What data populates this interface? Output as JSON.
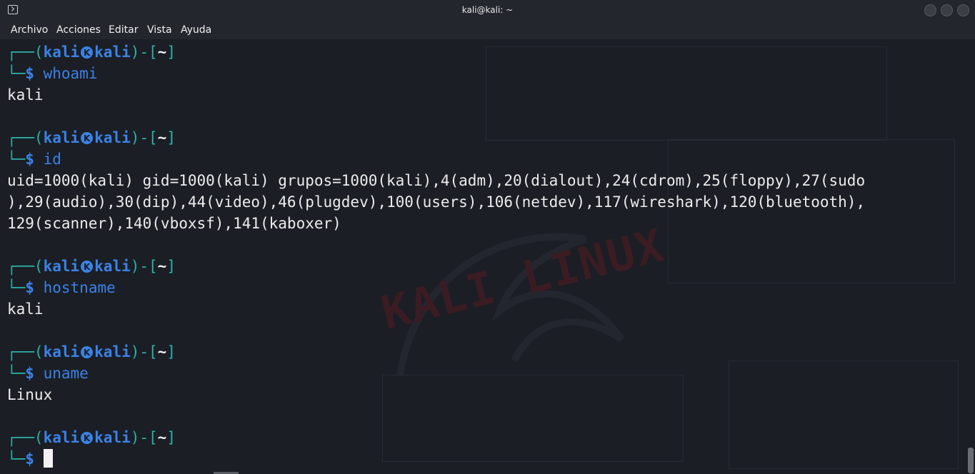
{
  "window": {
    "title": "kali@kali: ~",
    "icon": "terminal-icon"
  },
  "menu": [
    "Archivo",
    "Acciones",
    "Editar",
    "Vista",
    "Ayuda"
  ],
  "prompt": {
    "top_prefix": "┌──(",
    "user": "kali",
    "symbol": "skull-icon",
    "host": "kali",
    "mid": ")-[",
    "cwd": "~",
    "end": "]",
    "bottom_prefix": "└─",
    "dollar": "$"
  },
  "blocks": [
    {
      "command": "whoami",
      "output": [
        "kali"
      ]
    },
    {
      "command": "id",
      "output": [
        "uid=1000(kali) gid=1000(kali) grupos=1000(kali),4(adm),20(dialout),24(cdrom),25(floppy),27(sudo",
        "),29(audio),30(dip),44(video),46(plugdev),100(users),106(netdev),117(wireshark),120(bluetooth),",
        "129(scanner),140(vboxsf),141(kaboxer)"
      ]
    },
    {
      "command": "hostname",
      "output": [
        "kali"
      ]
    },
    {
      "command": "uname",
      "output": [
        "Linux"
      ]
    },
    {
      "command": "",
      "output": []
    }
  ],
  "colors": {
    "background": "#1b1e25",
    "prompt_line": "#2cb2a8",
    "prompt_user": "#3b82e6",
    "text": "#ececec"
  }
}
